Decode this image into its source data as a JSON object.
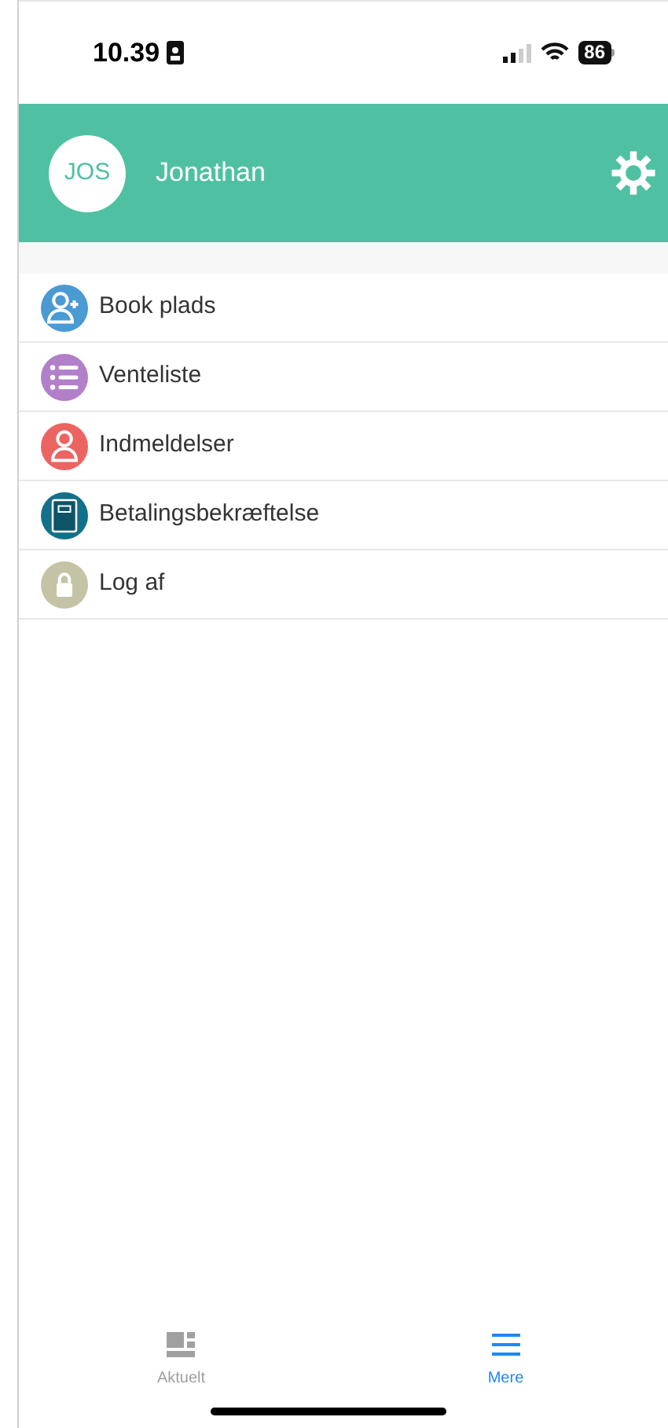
{
  "status_bar": {
    "time": "10.39",
    "battery": "86"
  },
  "header": {
    "initials": "JOS",
    "name": "Jonathan"
  },
  "menu": [
    {
      "kind": "person-add",
      "label": "Book plads",
      "color": "#4a9ad4"
    },
    {
      "kind": "list",
      "label": "Venteliste",
      "color": "#b27fc9"
    },
    {
      "kind": "person",
      "label": "Indmeldelser",
      "color": "#ec6461"
    },
    {
      "kind": "notebook",
      "label": "Betalingsbekræftelse",
      "color": "#13708a"
    },
    {
      "kind": "lock",
      "label": "Log af",
      "color": "#c4c3a6"
    }
  ],
  "tabs": [
    {
      "kind": "dashboard",
      "label": "Aktuelt",
      "selected": false
    },
    {
      "kind": "menu",
      "label": "Mere",
      "selected": true
    }
  ]
}
